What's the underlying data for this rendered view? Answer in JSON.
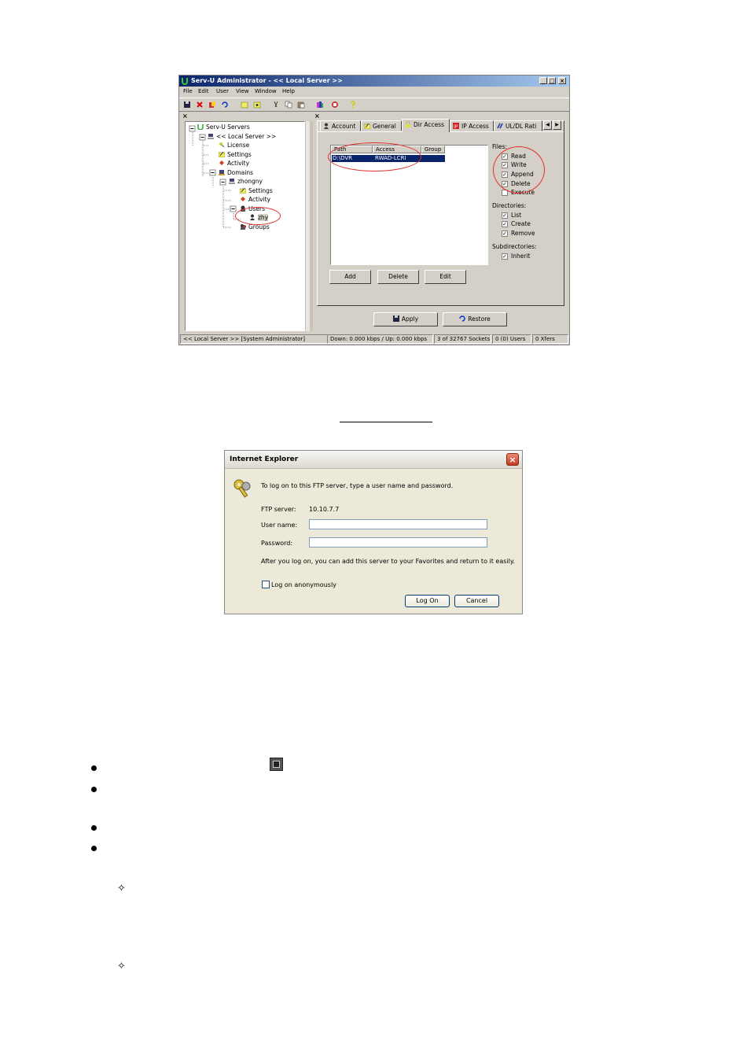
{
  "servu": {
    "title": "Serv-U Administrator - << Local Server >>",
    "window_buttons": [
      "_",
      "□",
      "×"
    ],
    "menu": [
      "File",
      "Edit",
      "User",
      "View",
      "Window",
      "Help"
    ],
    "pane_close": "×",
    "tree": [
      {
        "label": "Serv-U Servers",
        "icon": "serv-u-icon"
      },
      {
        "label": "<< Local Server >>",
        "icon": "server-icon"
      },
      {
        "label": "License",
        "icon": "key-icon"
      },
      {
        "label": "Settings",
        "icon": "settings-icon"
      },
      {
        "label": "Activity",
        "icon": "activity-icon"
      },
      {
        "label": "Domains",
        "icon": "domains-icon"
      },
      {
        "label": "zhongny",
        "icon": "domain-icon"
      },
      {
        "label": "Settings",
        "icon": "settings-icon"
      },
      {
        "label": "Activity",
        "icon": "activity-icon"
      },
      {
        "label": "Users",
        "icon": "users-icon"
      },
      {
        "label": "zhy",
        "icon": "user-icon"
      },
      {
        "label": "Groups",
        "icon": "groups-icon"
      }
    ],
    "tabs": [
      "Account",
      "General",
      "Dir Access",
      "IP Access",
      "UL/DL Rati"
    ],
    "columns": [
      "Path",
      "Access",
      "Group"
    ],
    "row": {
      "path": "D:\\DVR",
      "access": "RWAD-LCRI"
    },
    "files_label": "Files:",
    "files": [
      {
        "label": "Read",
        "checked": "✓"
      },
      {
        "label": "Write",
        "checked": "✓"
      },
      {
        "label": "Append",
        "checked": "✓"
      },
      {
        "label": "Delete",
        "checked": "✓"
      },
      {
        "label": "Execute",
        "checked": ""
      }
    ],
    "directories_label": "Directories:",
    "directories": [
      {
        "label": "List",
        "checked": "✓"
      },
      {
        "label": "Create",
        "checked": "✓"
      },
      {
        "label": "Remove",
        "checked": "✓"
      }
    ],
    "subdirectories_label": "Subdirectories:",
    "inherit": {
      "label": "Inherit",
      "checked": "✓"
    },
    "buttons": {
      "add": "Add",
      "delete": "Delete",
      "edit": "Edit",
      "apply": "Apply",
      "restore": "Restore"
    },
    "status": [
      "<< Local Server >>   [System Administrator]",
      "Down: 0.000 kbps / Up: 0.000 kbps",
      "3 of 32767 Sockets",
      "0 (0) Users",
      "0 Xfers"
    ]
  },
  "ie": {
    "title": "Internet Explorer",
    "prompt": "To log on to this FTP server, type a user name and password.",
    "ftp_label": "FTP server:",
    "ftp_value": "10.10.7.7",
    "user_label": "User name:",
    "password_label": "Password:",
    "user_value": "",
    "password_value": "",
    "note": "After you log on, you can add this server to your Favorites and return to it easily.",
    "anon_label": "Log on anonymously",
    "logon": "Log On",
    "cancel": "Cancel"
  }
}
